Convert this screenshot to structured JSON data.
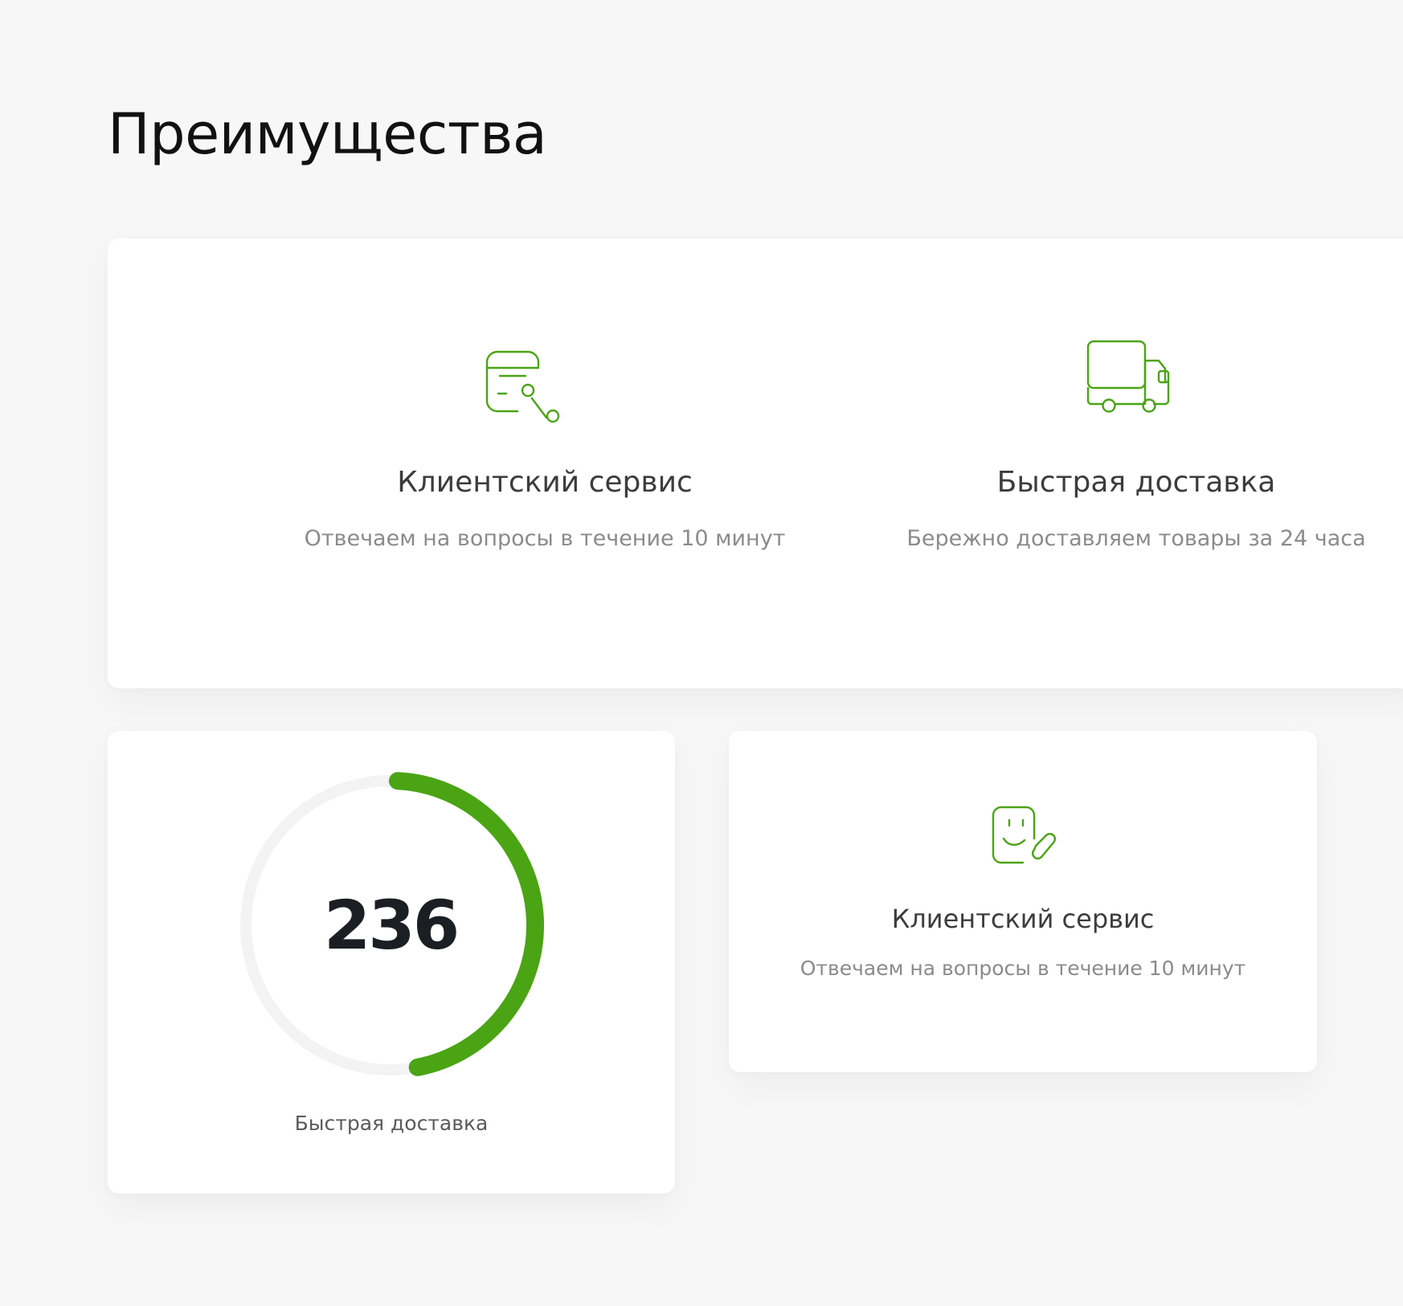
{
  "section": {
    "title": "Преимущества"
  },
  "features": {
    "service": {
      "title": "Клиентский сервис",
      "description": "Отвечаем на вопросы в течение 10 минут",
      "icon": "discount-card-icon"
    },
    "delivery": {
      "title": "Быстрая доставка",
      "description": "Бережно доставляем товары за 24 часа",
      "icon": "delivery-truck-icon"
    },
    "service_secondary": {
      "title": "Клиентский сервис",
      "description": "Отвечаем на вопросы в течение 10 минут",
      "icon": "smile-edit-icon"
    }
  },
  "stat": {
    "value": "236",
    "label": "Быстрая доставка",
    "progress_fraction": 0.47
  },
  "colors": {
    "accent": "#4aa414",
    "ring_track": "#f3f3f3",
    "background": "#f7f7f7",
    "card": "#ffffff",
    "title_text": "#111111",
    "muted_text": "#8b8b8b"
  }
}
